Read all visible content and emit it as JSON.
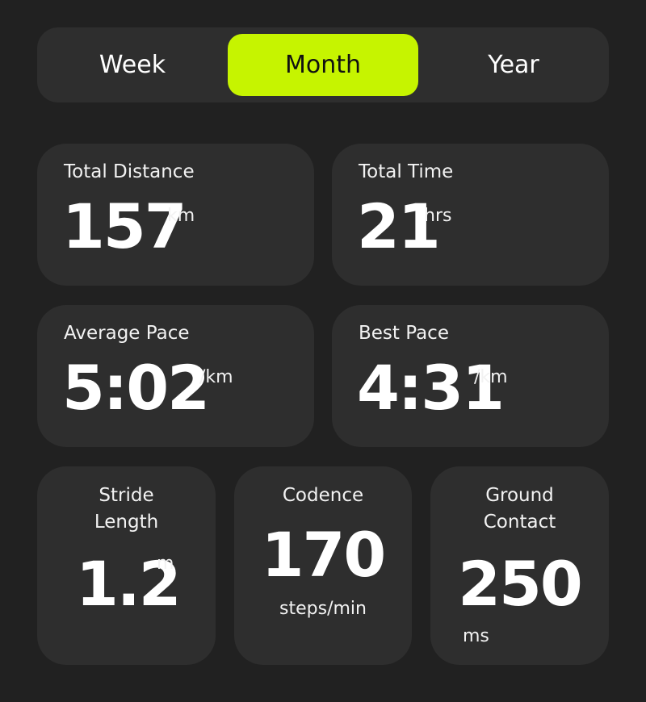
{
  "tabs": [
    {
      "label": "Week",
      "active": false
    },
    {
      "label": "Month",
      "active": true
    },
    {
      "label": "Year",
      "active": false
    }
  ],
  "colors": {
    "background": "#212121",
    "card": "#2e2e2e",
    "accent": "#c6f400"
  },
  "stats": {
    "total_distance": {
      "label": "Total Distance",
      "value": "157",
      "unit": "km"
    },
    "total_time": {
      "label": "Total Time",
      "value": "21",
      "unit": "hrs"
    },
    "average_pace": {
      "label": "Average Pace",
      "value": "5:02",
      "unit": "/km"
    },
    "best_pace": {
      "label": "Best Pace",
      "value": "4:31",
      "unit": "/km"
    },
    "stride_length": {
      "label_line1": "Stride",
      "label_line2": "Length",
      "value": "1.2",
      "unit": "m"
    },
    "cadence": {
      "label": "Codence",
      "value": "170",
      "unit": "steps/min"
    },
    "ground_contact": {
      "label_line1": "Ground",
      "label_line2": "Contact",
      "value": "250",
      "unit": "ms"
    }
  }
}
